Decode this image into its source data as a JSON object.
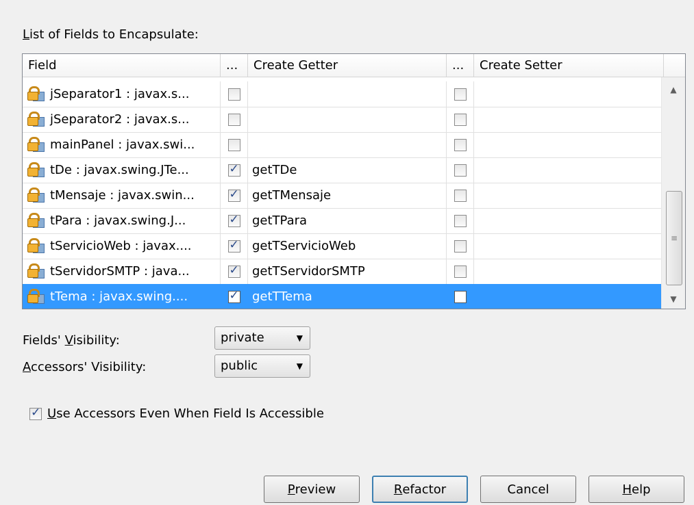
{
  "list_label_prefix": "L",
  "list_label_rest": "ist of Fields to Encapsulate:",
  "columns": [
    "Field",
    "...",
    "Create Getter",
    "...",
    "Create Setter"
  ],
  "rows": [
    {
      "field": "jSeparator1 : javax.s...",
      "getter_checked": false,
      "getter": "",
      "setter_checked": false
    },
    {
      "field": "jSeparator2 : javax.s...",
      "getter_checked": false,
      "getter": "",
      "setter_checked": false
    },
    {
      "field": "mainPanel : javax.swi...",
      "getter_checked": false,
      "getter": "",
      "setter_checked": false
    },
    {
      "field": "tDe : javax.swing.JTe...",
      "getter_checked": true,
      "getter": "getTDe",
      "setter_checked": false
    },
    {
      "field": "tMensaje : javax.swin...",
      "getter_checked": true,
      "getter": "getTMensaje",
      "setter_checked": false
    },
    {
      "field": "tPara : javax.swing.J...",
      "getter_checked": true,
      "getter": "getTPara",
      "setter_checked": false
    },
    {
      "field": "tServicioWeb : javax....",
      "getter_checked": true,
      "getter": "getTServicioWeb",
      "setter_checked": false
    },
    {
      "field": "tServidorSMTP : java...",
      "getter_checked": true,
      "getter": "getTServidorSMTP",
      "setter_checked": false
    },
    {
      "field": "tTema : javax.swing....",
      "getter_checked": true,
      "getter": "getTTema",
      "setter_checked": false,
      "selected": true
    }
  ],
  "fields_visibility": {
    "label_pre": "Fields' ",
    "label_u": "V",
    "label_post": "isibility:",
    "value": "private"
  },
  "accessors_visibility": {
    "label_u": "A",
    "label_post": "ccessors' Visibility:",
    "value": "public"
  },
  "use_accessors": {
    "checked": true,
    "label_u": "U",
    "label_post": "se Accessors Even When Field Is Accessible"
  },
  "buttons": {
    "preview": {
      "u": "P",
      "rest": "review"
    },
    "refactor": {
      "u": "R",
      "rest": "efactor"
    },
    "cancel": "Cancel",
    "help": {
      "u": "H",
      "rest": "elp"
    }
  },
  "colors": {
    "selection": "#3399ff",
    "background": "#f0f0f0"
  }
}
